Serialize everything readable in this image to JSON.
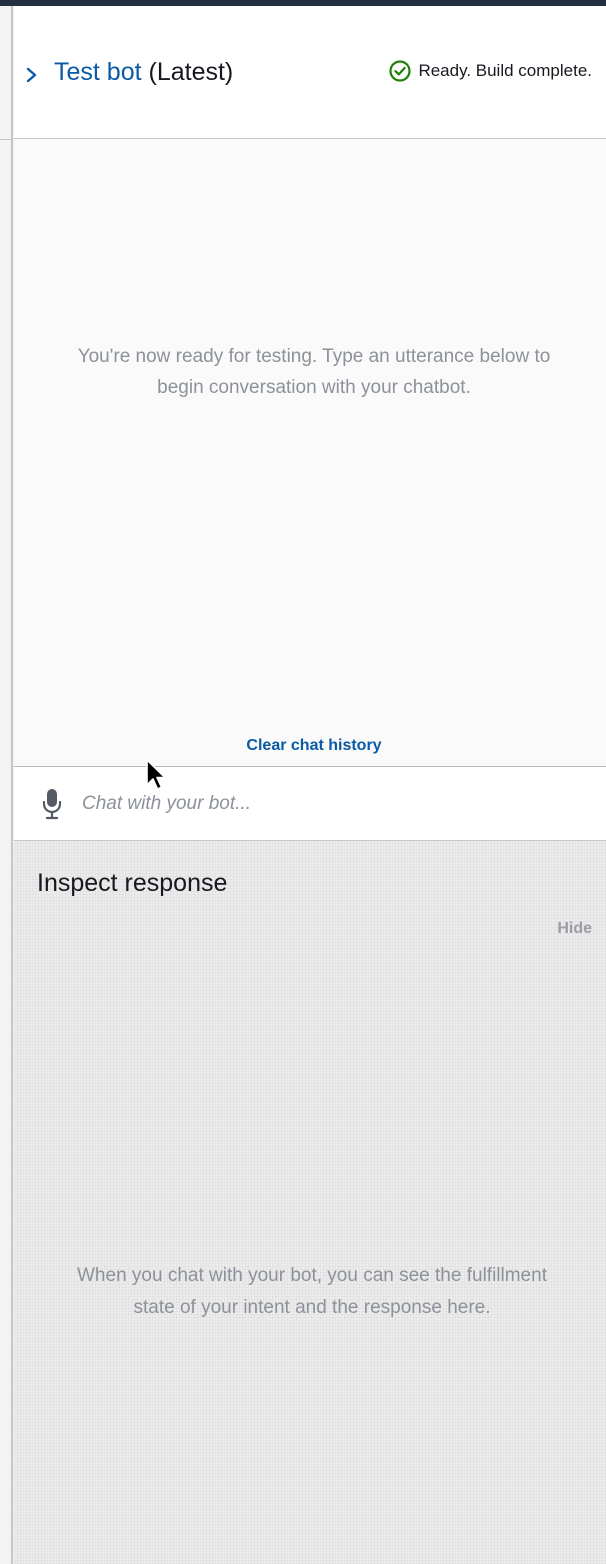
{
  "header": {
    "title_link": "Test bot",
    "title_suffix": " (Latest)",
    "status_text": "Ready. Build complete."
  },
  "chat": {
    "empty_message": "You're now ready for testing. Type an utterance below to begin conversation with your chatbot.",
    "clear_history": "Clear chat history",
    "input_placeholder": "Chat with your bot..."
  },
  "inspect": {
    "title": "Inspect response",
    "hide": "Hide",
    "empty_message": "When you chat with your bot, you can see the fulfillment state of your intent and the response here."
  },
  "icons": {
    "collapse": "chevron-right-icon",
    "status": "check-circle-icon",
    "mic": "microphone-icon"
  },
  "colors": {
    "link": "#0a5aa5",
    "success": "#1d8102",
    "muted_text": "#8d9199",
    "topbar": "#232f3e"
  }
}
